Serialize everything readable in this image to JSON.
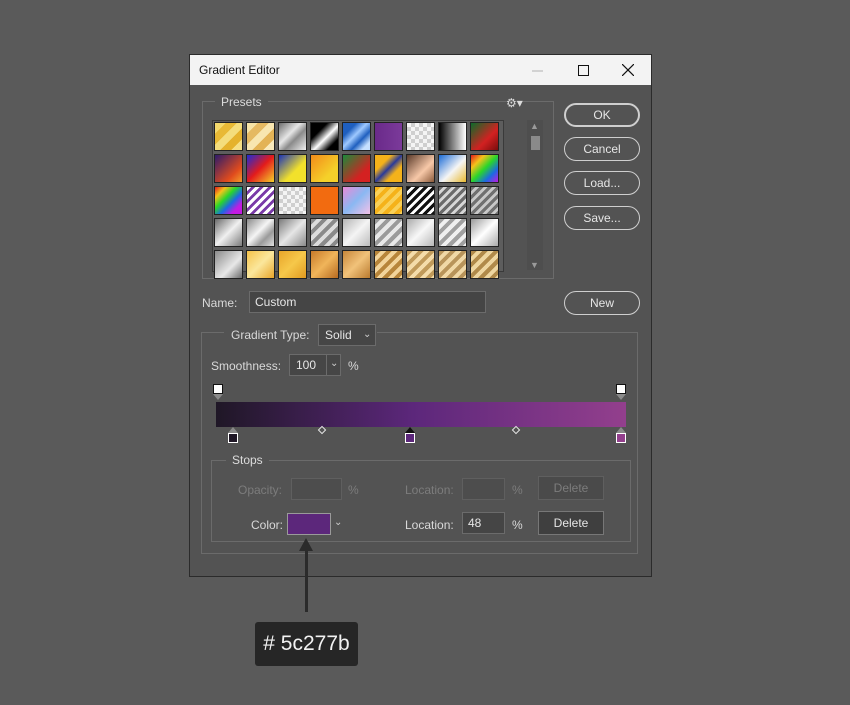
{
  "window": {
    "title": "Gradient Editor"
  },
  "presets": {
    "label": "Presets",
    "gear_icon": "gear-icon",
    "rows": [
      [
        "linear-gradient(135deg,#f3d86c 0 20%,#e8b935 20% 40%,#f4dd7c 40% 60%,#e5b22d 60% 80%,#f6df86 80%)",
        "linear-gradient(135deg,#f6e3a6 0 20%,#e5b962 20% 40%,#f8e6b0 40% 60%,#e3b356 60% 80%,#f9eabc 80%)",
        "linear-gradient(135deg,#6d6d6d,#e6e6e6 40%,#8a8a8a 60%,#f0f0f0)",
        "linear-gradient(135deg,#000 30%,#fff 55%,#000 80%)",
        "linear-gradient(135deg,#1f5fbf 0 25%,#9ec9ff 45%,#1f5fbf 65%,#c6e0ff 85%)",
        "linear-gradient(90deg,#6a2a8a,#7b3a9a)",
        "repeating-conic-gradient(#cfcfcf 0 25%,#f4f4f4 0 50%) 0 0/8px 8px",
        "linear-gradient(90deg,#000,#fff)",
        "linear-gradient(135deg,#0b6b2a,#d32121 60%,#7a0d0d)"
      ],
      [
        "linear-gradient(135deg,#2c1b6b,#e04b1d 70%,#f49b2a)",
        "linear-gradient(135deg,#1d2bd6,#e31b1b 50%,#f5d22a)",
        "linear-gradient(135deg,#1a33b8,#f2e12b 60%)",
        "linear-gradient(135deg,#f28b1a,#f5d12a 70%)",
        "linear-gradient(135deg,#1a8a3a,#d42121 70%)",
        "linear-gradient(135deg,#f4b21a 0 30%,#2a3a9a 50%,#f4b21a 70%)",
        "linear-gradient(135deg,#5a3a2a,#f7c8a8 60%,#8a5a3a)",
        "linear-gradient(135deg,#1a6ad6,#f5f5f5 55%,#e8b930)",
        "linear-gradient(135deg,#e21b1b,#f5c21b 25%,#2ad62a 50%,#1b6ae2 75%,#c21be2)"
      ],
      [
        "linear-gradient(135deg,#e21b1b,#f5c21b 20%,#2ad62a 40%,#1b6ae2 60%,#c21be2 80%)",
        "repeating-linear-gradient(135deg,#fff 0 3px,#7a3aa8 3px 6px)",
        "repeating-conic-gradient(#cfcfcf 0 25%,#f4f4f4 0 50%) 0 0/8px 8px",
        "linear-gradient(90deg,#f26b10,#f26b10)",
        "linear-gradient(135deg,#e88ad6,#8ab8f2 50%,#f5c1e8)",
        "repeating-linear-gradient(135deg,#f5b21a 0 4px,#f9d15a 4px 8px)",
        "repeating-linear-gradient(135deg,#111 0 3px,#fff 3px 6px)",
        "repeating-linear-gradient(135deg,#6a6a6a 0 3px,#d6d6d6 3px 6px)",
        "repeating-linear-gradient(135deg,#707070 0 3px,#c8c8c8 3px 6px)"
      ],
      [
        "linear-gradient(135deg,#6a6a6a,#f0f0f0 50%,#7a7a7a)",
        "linear-gradient(135deg,#8a8a8a,#f5f5f5 45%,#9a9a9a 70%,#e0e0e0)",
        "linear-gradient(135deg,#7a7a7a,#e6e6e6 50%,#8a8a8a)",
        "repeating-linear-gradient(135deg,#8a8a8a 0 4px,#dcdcdc 4px 8px)",
        "linear-gradient(135deg,#b5b5b5,#f4f4f4 50%,#bcbcbc)",
        "repeating-linear-gradient(135deg,#9a9a9a 0 4px,#e8e8e8 4px 8px)",
        "linear-gradient(135deg,#aaa,#f8f8f8 50%,#b8b8b8)",
        "repeating-linear-gradient(135deg,#a0a0a0 0 4px,#f0f0f0 4px 8px)",
        "linear-gradient(135deg,#9a9a9a,#fff 50%,#aaa)"
      ],
      [
        "linear-gradient(135deg,#8a8a8a,#e8e8e8 60%,#6a6a6a)",
        "linear-gradient(135deg,#f5c24a,#fbe79c 50%,#e8a52a)",
        "linear-gradient(135deg,#e8a52a,#f6c84a 50%,#e19a1f)",
        "linear-gradient(135deg,#c97a2a,#f0b55a 50%,#b76a20)",
        "linear-gradient(135deg,#c8873a,#f1c27a 50%,#b97a2e)",
        "repeating-linear-gradient(135deg,#b7853a 0 4px,#f2d49a 4px 8px)",
        "repeating-linear-gradient(135deg,#c09a5a 0 4px,#f4dcaa 4px 8px)",
        "repeating-linear-gradient(135deg,#b8945a 0 4px,#f0d8a6 4px 8px)",
        "repeating-linear-gradient(135deg,#b08a4a 0 4px,#eed6a0 4px 8px)"
      ]
    ]
  },
  "buttons": {
    "ok": "OK",
    "cancel": "Cancel",
    "load": "Load...",
    "save": "Save...",
    "new": "New"
  },
  "name": {
    "label": "Name:",
    "value": "Custom"
  },
  "gradient_type": {
    "label": "Gradient Type:",
    "value": "Solid"
  },
  "smoothness": {
    "label": "Smoothness:",
    "value": "100",
    "unit": "%"
  },
  "gradient": {
    "colors": [
      "#1f1726",
      "#5c277b",
      "#933f8d"
    ]
  },
  "stops": {
    "label": "Stops",
    "opacity_label": "Opacity:",
    "opacity_value": "",
    "opacity_unit": "%",
    "opacity_location_label": "Location:",
    "opacity_location_value": "",
    "opacity_location_unit": "%",
    "opacity_delete": "Delete",
    "color_label": "Color:",
    "color_value": "#5c277b",
    "color_location_label": "Location:",
    "color_location_value": "48",
    "color_location_unit": "%",
    "color_delete": "Delete"
  },
  "callout": {
    "text": "# 5c277b"
  }
}
